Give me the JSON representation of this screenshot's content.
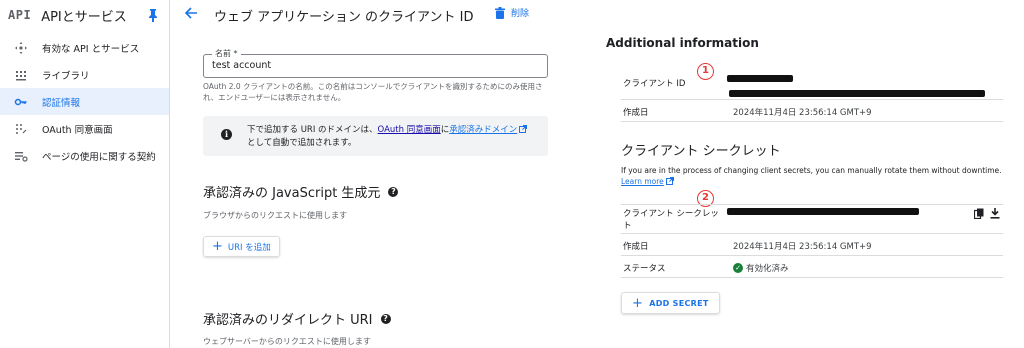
{
  "sidebar": {
    "logo": "API",
    "title": "APIとサービス",
    "items": [
      {
        "label": "有効な API とサービス",
        "icon": "api-services-icon"
      },
      {
        "label": "ライブラリ",
        "icon": "library-icon"
      },
      {
        "label": "認証情報",
        "icon": "key-icon",
        "active": true
      },
      {
        "label": "OAuth 同意画面",
        "icon": "consent-screen-icon"
      },
      {
        "label": "ページの使用に関する契約",
        "icon": "settings-list-icon"
      }
    ]
  },
  "header": {
    "title": "ウェブ アプリケーション のクライアント ID",
    "delete_label": "削除"
  },
  "form": {
    "name_label": "名前 *",
    "name_value": "test account",
    "name_hint": "OAuth 2.0 クライアントの名前。この名前はコンソールでクライアントを識別するためにのみ使用され、エンドユーザーには表示されません。",
    "info_prefix": "下で追加する URI のドメインは、",
    "info_link1": "OAuth 同意画面",
    "info_mid": "に",
    "info_link2": "承認済みドメイン",
    "info_suffix": "として自動で追加されます。"
  },
  "js_origins": {
    "title": "承認済みの JavaScript 生成元",
    "subtitle": "ブラウザからのリクエストに使用します",
    "add_label": "URI を追加"
  },
  "redirect_uris": {
    "title": "承認済みのリダイレクト URI",
    "subtitle": "ウェブサーバーからのリクエストに使用します"
  },
  "additional": {
    "title": "Additional information",
    "client_id_label": "クライアント ID",
    "created_label": "作成日",
    "created_value": "2024年11月4日 23:56:14 GMT+9"
  },
  "secret": {
    "title": "クライアント シークレット",
    "description": "If you are in the process of changing client secrets, you can manually rotate them without downtime.",
    "learn_more": "Learn more",
    "secret_label": "クライアント シークレット",
    "created_label": "作成日",
    "created_value": "2024年11月4日 23:56:14 GMT+9",
    "status_label": "ステータス",
    "status_value": "有効化済み",
    "add_label": "ADD SECRET"
  },
  "annotations": {
    "badge1": "1",
    "badge2": "2",
    "color": "#e53935"
  },
  "colors": {
    "accent": "#1a73e8",
    "active_bg": "#e8f0fe",
    "success": "#188038"
  }
}
